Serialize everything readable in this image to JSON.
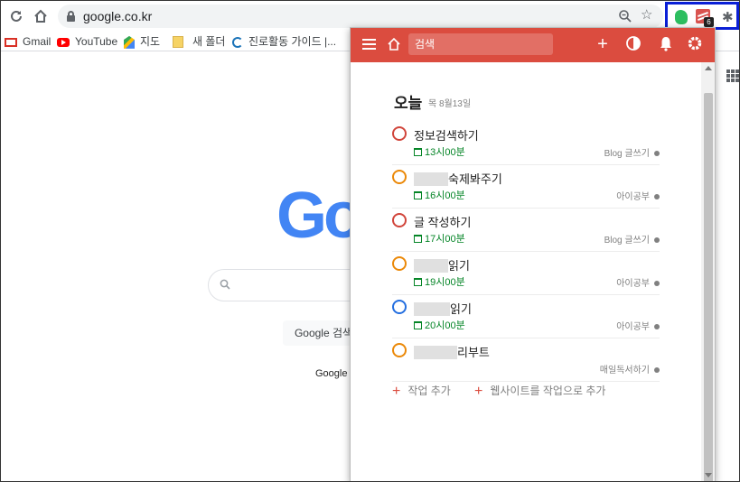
{
  "browser": {
    "url": "google.co.kr",
    "extensions": {
      "todo_badge": "6"
    }
  },
  "bookmarks": [
    {
      "label": "Gmail",
      "icon": "gmail-icon"
    },
    {
      "label": "YouTube",
      "icon": "youtube-icon"
    },
    {
      "label": "지도",
      "icon": "maps-icon"
    },
    {
      "label": "새 폴더",
      "icon": "folder-icon"
    },
    {
      "label": "진로활동 가이드 |...",
      "icon": "c-logo-icon"
    }
  ],
  "google": {
    "logo_text": "Go",
    "search_button": "Google 검색",
    "language_text": "Google 제"
  },
  "popup": {
    "search_placeholder": "검색",
    "today_label": "오늘",
    "today_date": "목 8월13일",
    "tasks": [
      {
        "title": "정보검색하기",
        "due": "13시00분",
        "project": "Blog 글쓰기",
        "priority_color": "#d1453b"
      },
      {
        "title": "숙제봐주기",
        "due": "16시00분",
        "project": "아이공부",
        "priority_color": "#eb8909"
      },
      {
        "title": "글 작성하기",
        "due": "17시00분",
        "project": "Blog 글쓰기",
        "priority_color": "#d1453b"
      },
      {
        "title": "읽기",
        "due": "19시00분",
        "project": "아이공부",
        "priority_color": "#eb8909"
      },
      {
        "title": "읽기",
        "due": "20시00분",
        "project": "아이공부",
        "priority_color": "#246fe0"
      },
      {
        "title": "리부트",
        "due": "",
        "project": "매일독서하기",
        "priority_color": "#eb8909"
      }
    ],
    "add_task_label": "작업 추가",
    "add_website_label": "웹사이트를 작업으로 추가"
  },
  "colors": {
    "todoist_red": "#db4c3f",
    "due_green": "#058527",
    "highlight_box": "#0a1fd6"
  }
}
